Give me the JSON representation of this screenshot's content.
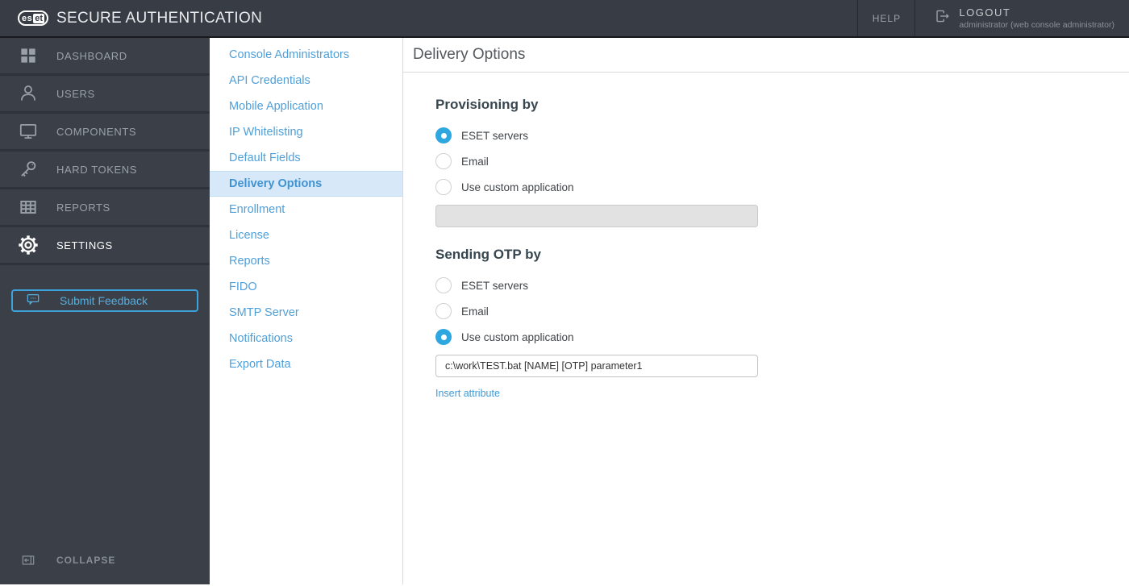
{
  "topbar": {
    "logo_text": "eset",
    "logo_es": "es",
    "logo_et": "et",
    "brand": "SECURE AUTHENTICATION",
    "help_label": "HELP",
    "logout_label": "LOGOUT",
    "logout_user": "administrator (web console administrator)"
  },
  "sidebar": {
    "items": [
      {
        "label": "DASHBOARD",
        "icon": "dashboard-grid-icon"
      },
      {
        "label": "USERS",
        "icon": "user-icon"
      },
      {
        "label": "COMPONENTS",
        "icon": "monitor-icon"
      },
      {
        "label": "HARD TOKENS",
        "icon": "key-icon"
      },
      {
        "label": "REPORTS",
        "icon": "table-grid-icon"
      },
      {
        "label": "SETTINGS",
        "icon": "gear-icon",
        "active": true
      }
    ],
    "feedback_label": "Submit Feedback",
    "collapse_label": "COLLAPSE"
  },
  "subnav": {
    "items": [
      {
        "label": "Console Administrators"
      },
      {
        "label": "API Credentials"
      },
      {
        "label": "Mobile Application"
      },
      {
        "label": "IP Whitelisting"
      },
      {
        "label": "Default Fields"
      },
      {
        "label": "Delivery Options",
        "active": true
      },
      {
        "label": "Enrollment"
      },
      {
        "label": "License"
      },
      {
        "label": "Reports"
      },
      {
        "label": "FIDO"
      },
      {
        "label": "SMTP Server"
      },
      {
        "label": "Notifications"
      },
      {
        "label": "Export Data"
      }
    ]
  },
  "main": {
    "title": "Delivery Options",
    "provisioning": {
      "heading": "Provisioning by",
      "options": [
        "ESET servers",
        "Email",
        "Use custom application"
      ],
      "selected": "ESET servers",
      "custom_app_value": ""
    },
    "otp": {
      "heading": "Sending OTP by",
      "options": [
        "ESET servers",
        "Email",
        "Use custom application"
      ],
      "selected": "Use custom application",
      "custom_app_value": "c:\\work\\TEST.bat [NAME] [OTP] parameter1",
      "insert_attribute_label": "Insert attribute"
    }
  },
  "colors": {
    "accent_blue": "#2ea7e0",
    "link_blue": "#4f9fd9",
    "active_nav_bg": "#d7e9f8",
    "topbar_bg": "#383d45",
    "sidebar_bg": "#3b4048"
  }
}
